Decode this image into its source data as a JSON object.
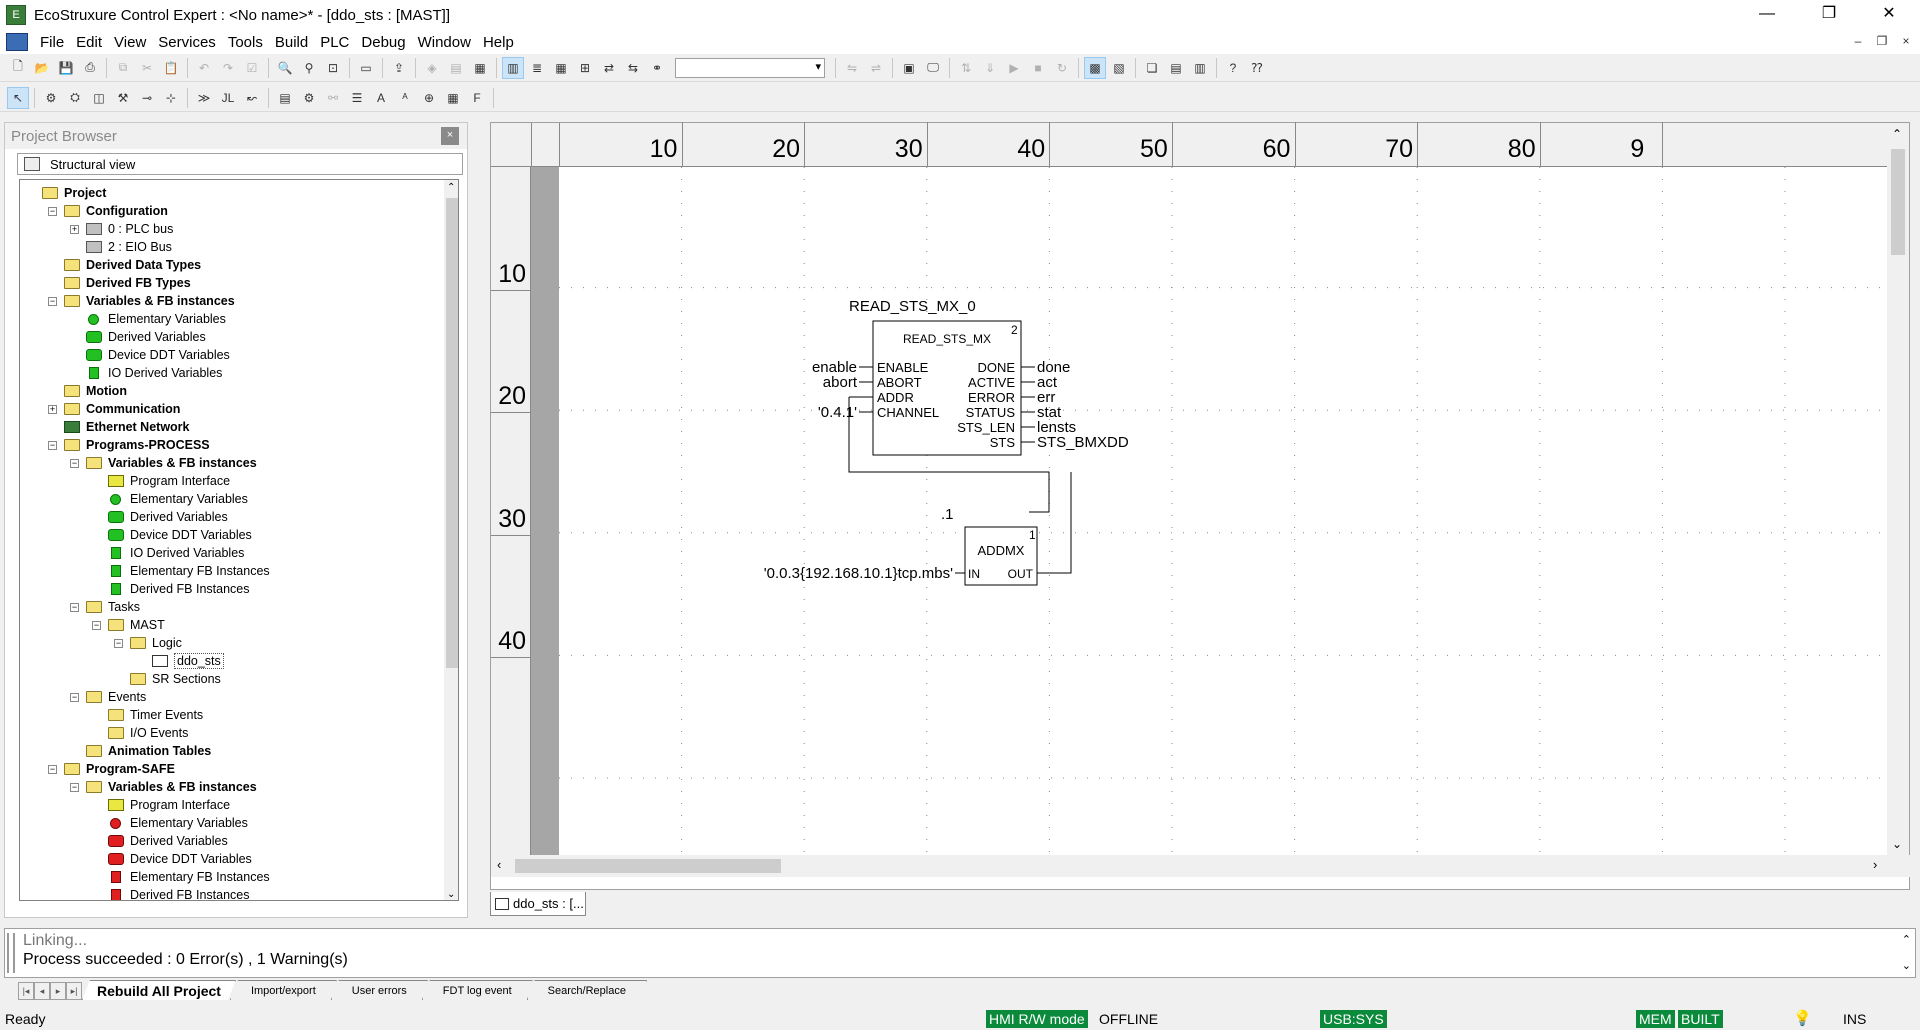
{
  "window": {
    "title": "EcoStruxure Control Expert : <No name>* - [ddo_sts : [MAST]]"
  },
  "menu": [
    "File",
    "Edit",
    "View",
    "Services",
    "Tools",
    "Build",
    "PLC",
    "Debug",
    "Window",
    "Help"
  ],
  "project_browser": {
    "title": "Project Browser",
    "view_label": "Structural view",
    "tree": [
      {
        "label": "Project",
        "depth": 0,
        "bold": true,
        "icon": "folder-icon"
      },
      {
        "label": "Configuration",
        "depth": 1,
        "bold": true,
        "icon": "folder-icon"
      },
      {
        "label": "0 : PLC bus",
        "depth": 2,
        "icon": "bus-icon"
      },
      {
        "label": "2 : EIO Bus",
        "depth": 2,
        "icon": "bus-icon"
      },
      {
        "label": "Derived Data Types",
        "depth": 1,
        "bold": true,
        "icon": "folder-icon"
      },
      {
        "label": "Derived FB Types",
        "depth": 1,
        "bold": true,
        "icon": "folder-icon"
      },
      {
        "label": "Variables & FB instances",
        "depth": 1,
        "bold": true,
        "icon": "folder-icon"
      },
      {
        "label": "Elementary Variables",
        "depth": 2,
        "icon": "green-dot-icon"
      },
      {
        "label": "Derived Variables",
        "depth": 2,
        "icon": "green-derived-icon"
      },
      {
        "label": "Device DDT Variables",
        "depth": 2,
        "icon": "green-derived-icon"
      },
      {
        "label": "IO Derived Variables",
        "depth": 2,
        "icon": "green-io-icon"
      },
      {
        "label": "Motion",
        "depth": 1,
        "bold": true,
        "icon": "folder-icon"
      },
      {
        "label": "Communication",
        "depth": 1,
        "bold": true,
        "icon": "folder-icon"
      },
      {
        "label": "Ethernet Network",
        "depth": 1,
        "bold": true,
        "icon": "network-icon"
      },
      {
        "label": "Programs-PROCESS",
        "depth": 1,
        "bold": true,
        "icon": "folder-icon"
      },
      {
        "label": "Variables & FB instances",
        "depth": 2,
        "bold": true,
        "icon": "folder-icon"
      },
      {
        "label": "Program Interface",
        "depth": 3,
        "icon": "interface-icon"
      },
      {
        "label": "Elementary Variables",
        "depth": 3,
        "icon": "green-dot-icon"
      },
      {
        "label": "Derived Variables",
        "depth": 3,
        "icon": "green-derived-icon"
      },
      {
        "label": "Device DDT Variables",
        "depth": 3,
        "icon": "green-derived-icon"
      },
      {
        "label": "IO Derived Variables",
        "depth": 3,
        "icon": "green-io-icon"
      },
      {
        "label": "Elementary FB Instances",
        "depth": 3,
        "icon": "green-fb-icon"
      },
      {
        "label": "Derived FB Instances",
        "depth": 3,
        "icon": "green-fb-icon"
      },
      {
        "label": "Tasks",
        "depth": 2,
        "icon": "folder-icon"
      },
      {
        "label": "MAST",
        "depth": 3,
        "icon": "folder-icon"
      },
      {
        "label": "Logic",
        "depth": 4,
        "icon": "folder-icon"
      },
      {
        "label": "ddo_sts",
        "depth": 5,
        "icon": "fbd-section-icon"
      },
      {
        "label": "SR Sections",
        "depth": 4,
        "icon": "folder-icon"
      },
      {
        "label": "Events",
        "depth": 2,
        "icon": "folder-icon"
      },
      {
        "label": "Timer Events",
        "depth": 3,
        "icon": "folder-icon"
      },
      {
        "label": "I/O Events",
        "depth": 3,
        "icon": "folder-icon"
      },
      {
        "label": "Animation Tables",
        "depth": 2,
        "bold": true,
        "icon": "folder-icon"
      },
      {
        "label": "Program-SAFE",
        "depth": 1,
        "bold": true,
        "icon": "folder-icon"
      },
      {
        "label": "Variables & FB instances",
        "depth": 2,
        "bold": true,
        "icon": "folder-icon"
      },
      {
        "label": "Program Interface",
        "depth": 3,
        "icon": "interface-icon"
      },
      {
        "label": "Elementary Variables",
        "depth": 3,
        "icon": "red-dot-icon"
      },
      {
        "label": "Derived Variables",
        "depth": 3,
        "icon": "red-derived-icon"
      },
      {
        "label": "Device DDT Variables",
        "depth": 3,
        "icon": "red-derived-icon"
      },
      {
        "label": "Elementary FB Instances",
        "depth": 3,
        "icon": "red-fb-icon"
      },
      {
        "label": "Derived FB Instances",
        "depth": 3,
        "icon": "red-fb-icon"
      }
    ]
  },
  "editor": {
    "col_ticks": [
      "10",
      "20",
      "30",
      "40",
      "50",
      "60",
      "70",
      "80",
      "9"
    ],
    "row_ticks": [
      "10",
      "20",
      "30",
      "40"
    ],
    "tab_label": "ddo_sts : [...",
    "blocks": {
      "read": {
        "instance": "READ_STS_MX_0",
        "type": "READ_STS_MX",
        "exec_order": "2",
        "inputs": [
          "ENABLE",
          "ABORT",
          "ADDR",
          "CHANNEL"
        ],
        "outputs": [
          "DONE",
          "ACTIVE",
          "ERROR",
          "STATUS",
          "STS_LEN",
          "STS"
        ],
        "in_vars": [
          "enable",
          "abort",
          "",
          "'0.4.1'"
        ],
        "out_vars": [
          "done",
          "act",
          "err",
          "stat",
          "lensts",
          "STS_BMXDD"
        ]
      },
      "addmx": {
        "instance": ".1",
        "type": "ADDMX",
        "exec_order": "1",
        "input": "IN",
        "output": "OUT",
        "in_var": "'0.0.3{192.168.10.1}tcp.mbs'"
      }
    }
  },
  "output": {
    "line1": "Linking...",
    "line2": "Process succeeded : 0 Error(s) , 1 Warning(s)",
    "tabs": [
      "Rebuild All Project",
      "Import/export",
      "User errors",
      "FDT log event",
      "Search/Replace"
    ]
  },
  "status": {
    "ready": "Ready",
    "hmi": "HMI R/W mode",
    "offline": "OFFLINE",
    "usb": "USB:SYS",
    "mem": "MEM",
    "built": "BUILT",
    "ins": "INS"
  },
  "colors": {
    "status_green": "#0a8a3a",
    "folder": "#f6e27a",
    "var_green": "#22c022",
    "var_red": "#e02020"
  }
}
